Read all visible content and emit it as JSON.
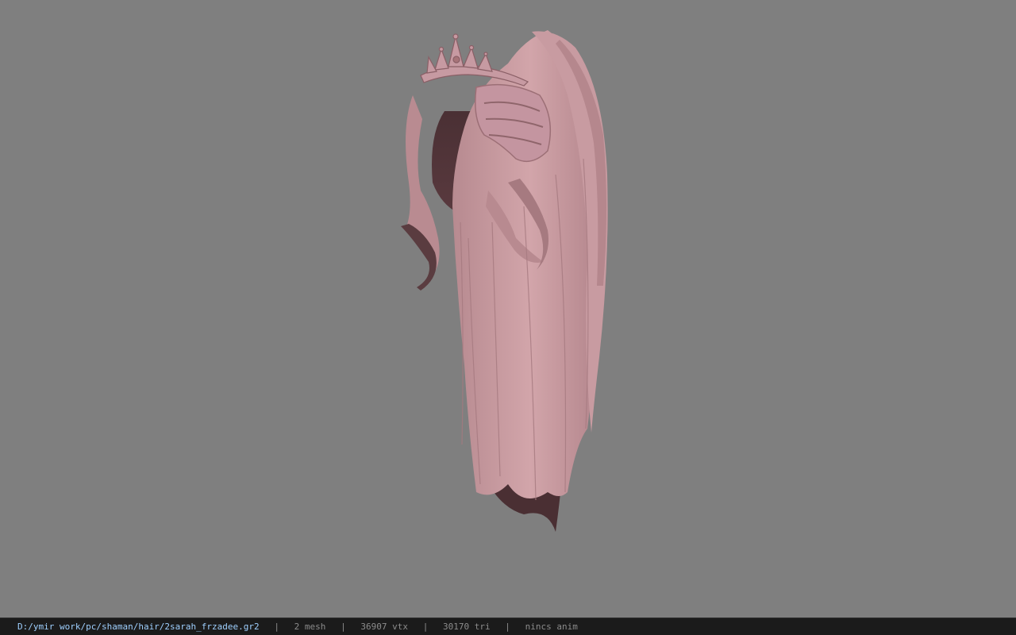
{
  "viewport": {
    "model_name": "hair model with tiara",
    "background_color": "#7f7f7f",
    "hair_color": "#c99aa0"
  },
  "statusbar": {
    "file_path": "D:/ymir work/pc/shaman/hair/2sarah_frzadee.gr2",
    "separator": "|",
    "mesh": "2 mesh",
    "vertices": "36907 vtx",
    "triangles": "30170 tri",
    "animation": "nincs anim"
  }
}
